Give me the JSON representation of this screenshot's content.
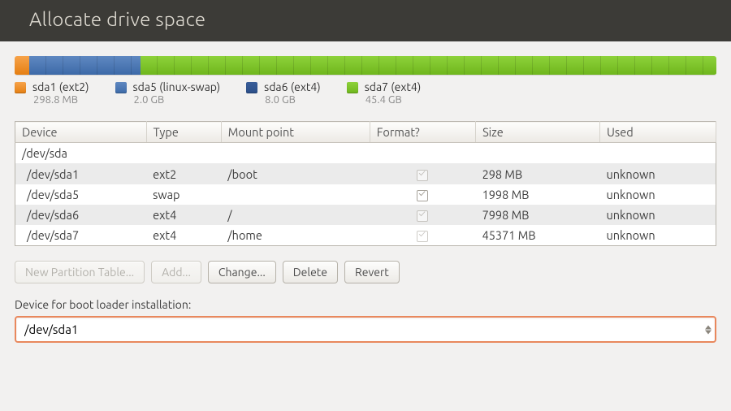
{
  "header": {
    "title": "Allocate drive space"
  },
  "legend": [
    {
      "color": "#e57f12",
      "swatch_class": "grad-orange",
      "label": "sda1 (ext2)",
      "size": "298.8 MB"
    },
    {
      "color": "#3d6aa8",
      "swatch_class": "grad-blue",
      "label": "sda5 (linux-swap)",
      "size": "2.0 GB"
    },
    {
      "color": "#2b4f89",
      "swatch_class": "grad-dblue",
      "label": "sda6 (ext4)",
      "size": "8.0 GB"
    },
    {
      "color": "#6fb61d",
      "swatch_class": "grad-green",
      "label": "sda7 (ext4)",
      "size": "45.4 GB"
    }
  ],
  "diskbar": [
    {
      "class": "grad-orange",
      "percent": 2.1
    },
    {
      "class": "grad-blue",
      "percent": 15.8
    },
    {
      "class": "grad-green",
      "percent": 82.1
    }
  ],
  "columns": {
    "device": "Device",
    "type": "Type",
    "mount": "Mount point",
    "format": "Format?",
    "size": "Size",
    "used": "Used"
  },
  "rows": [
    {
      "device": "/dev/sda",
      "type": "",
      "mount": "",
      "format": null,
      "size": "",
      "used": "",
      "indent": false
    },
    {
      "device": "/dev/sda1",
      "type": "ext2",
      "mount": "/boot",
      "format": "checked-disabled",
      "size": "298 MB",
      "used": "unknown",
      "indent": true
    },
    {
      "device": "/dev/sda5",
      "type": "swap",
      "mount": "",
      "format": "unchecked",
      "size": "1998 MB",
      "used": "unknown",
      "indent": true
    },
    {
      "device": "/dev/sda6",
      "type": "ext4",
      "mount": "/",
      "format": "checked-disabled",
      "size": "7998 MB",
      "used": "unknown",
      "indent": true
    },
    {
      "device": "/dev/sda7",
      "type": "ext4",
      "mount": "/home",
      "format": "checked-disabled",
      "size": "45371 MB",
      "used": "unknown",
      "indent": true
    }
  ],
  "buttons": {
    "new_table": "New Partition Table...",
    "add": "Add...",
    "change": "Change...",
    "delete": "Delete",
    "revert": "Revert"
  },
  "bootloader": {
    "label": "Device for boot loader installation:",
    "value": "/dev/sda1"
  }
}
